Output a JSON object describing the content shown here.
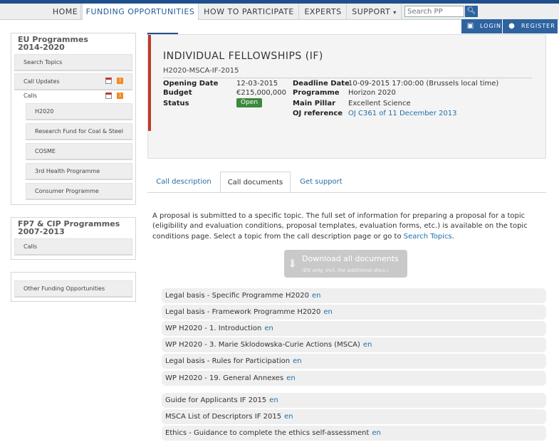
{
  "nav": {
    "items": [
      "HOME",
      "FUNDING OPPORTUNITIES",
      "HOW TO PARTICIPATE",
      "EXPERTS",
      "SUPPORT"
    ],
    "active": "FUNDING OPPORTUNITIES",
    "support_caret": "▾",
    "search_placeholder": "Search PP",
    "login": "LOGIN",
    "register": "REGISTER"
  },
  "sidebar": {
    "eu_title": "EU Programmes 2014-2020",
    "eu_items": {
      "search_topics": "Search Topics",
      "call_updates": "Call Updates",
      "calls": "Calls",
      "h2020": "H2020",
      "rfcs": "Research Fund for Coal & Steel",
      "cosme": "COSME",
      "health": "3rd Health Programme",
      "consumer": "Consumer Programme"
    },
    "fp7_title": "FP7 & CIP Programmes 2007-2013",
    "fp7_calls": "Calls",
    "other": "Other Funding Opportunities"
  },
  "call": {
    "title": "INDIVIDUAL FELLOWSHIPS (IF)",
    "identifier": "H2020-MSCA-IF-2015",
    "opening_date_label": "Opening Date",
    "opening_date": "12-03-2015",
    "budget_label": "Budget",
    "budget": "€215,000,000",
    "status_label": "Status",
    "status": "Open",
    "deadline_label": "Deadline Date",
    "deadline": "10-09-2015 17:00:00 (Brussels local time)",
    "programme_label": "Programme",
    "programme": "Horizon 2020",
    "pillar_label": "Main Pillar",
    "pillar": "Excellent Science",
    "oj_label": "OJ reference",
    "oj": "OJ C361 of 11 December 2013",
    "status_color": "#3b8a3b"
  },
  "tabs": [
    "Call description",
    "Call documents",
    "Get support"
  ],
  "active_tab": "Call documents",
  "intro": {
    "text": "A proposal is submitted to a specific topic. The full set of information for preparing a proposal for a topic (eligibility and evaluation conditions, proposal templates, evaluation forms, etc.) is available on the topic conditions page. Select a topic from the call description page or go to",
    "link": "Search Topics",
    "end": "."
  },
  "download": {
    "label": "Download all documents",
    "note": "(EN only, incl. the additional docs.)",
    "icon": "download-icon"
  },
  "documents": [
    {
      "title": "Legal basis - Specific Programme H2020",
      "lang": "en"
    },
    {
      "title": "Legal basis - Framework Programme H2020",
      "lang": "en"
    },
    {
      "title": "WP H2020 - 1. Introduction",
      "lang": "en"
    },
    {
      "title": "WP H2020 - 3. Marie Sklodowska-Curie Actions (MSCA)",
      "lang": "en"
    },
    {
      "title": "Legal basis - Rules for Participation",
      "lang": "en"
    },
    {
      "title": "WP H2020 - 19. General Annexes",
      "lang": "en"
    }
  ],
  "documents2": [
    {
      "title": "Guide for Applicants IF 2015",
      "lang": "en"
    },
    {
      "title": "MSCA List of Descriptors IF 2015",
      "lang": "en"
    },
    {
      "title": "Ethics - Guidance to complete the ethics self-assessment",
      "lang": "en"
    }
  ],
  "colors": {
    "brand": "#1f4f8c",
    "link": "#1f6fa8",
    "accent_bar": "#c0392b"
  }
}
